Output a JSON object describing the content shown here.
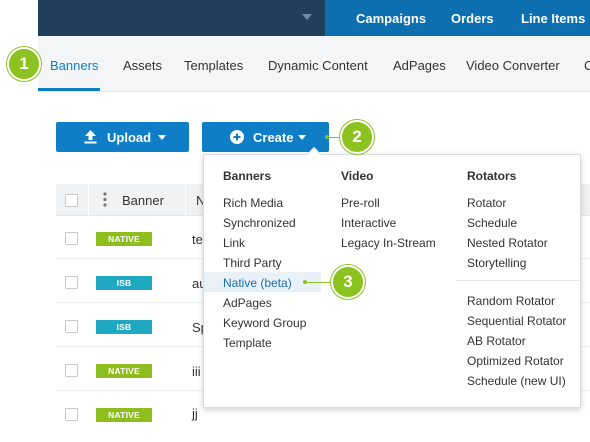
{
  "topbar": {
    "nav": [
      "Campaigns",
      "Orders",
      "Line Items"
    ]
  },
  "subtabs": [
    "Banners",
    "Assets",
    "Templates",
    "Dynamic Content",
    "AdPages",
    "Video Converter",
    "C"
  ],
  "buttons": {
    "upload_label": "Upload",
    "create_label": "Create"
  },
  "table": {
    "header_banner": "Banner",
    "header_name_partial": "N",
    "rows": [
      {
        "type": "NATIVE",
        "name": "te"
      },
      {
        "type": "ISB",
        "name": "au"
      },
      {
        "type": "ISB",
        "name": "Sp"
      },
      {
        "type": "NATIVE",
        "name": "iii"
      },
      {
        "type": "NATIVE",
        "name": "jj"
      }
    ]
  },
  "create_menu": {
    "banners": {
      "heading": "Banners",
      "items": [
        "Rich Media",
        "Synchronized",
        "Link",
        "Third Party",
        "Native (beta)",
        "AdPages",
        "Keyword Group",
        "Template"
      ]
    },
    "video": {
      "heading": "Video",
      "items": [
        "Pre-roll",
        "Interactive",
        "Legacy In-Stream"
      ]
    },
    "rotators": {
      "heading": "Rotators",
      "items": [
        "Rotator",
        "Schedule",
        "Nested Rotator",
        "Storytelling"
      ],
      "items2": [
        "Random Rotator",
        "Sequential Rotator",
        "AB Rotator",
        "Optimized Rotator",
        "Schedule (new UI)"
      ]
    },
    "highlighted_item": "Native (beta)"
  },
  "callouts": [
    "1",
    "2",
    "3"
  ],
  "colors": {
    "topbar_dark": "#1f3f5b",
    "topbar_nav": "#0d6eb0",
    "primary_button": "#0f7ec6",
    "active_tab": "#0d7ec4",
    "callout_green": "#8bc21f",
    "badge_native": "#8ebd1e",
    "badge_isb": "#1fa8c2"
  },
  "icons": {
    "upload": "upload-arrow-icon",
    "create": "plus-circle-icon",
    "caret": "caret-down-icon",
    "drag": "vertical-dots-icon"
  }
}
